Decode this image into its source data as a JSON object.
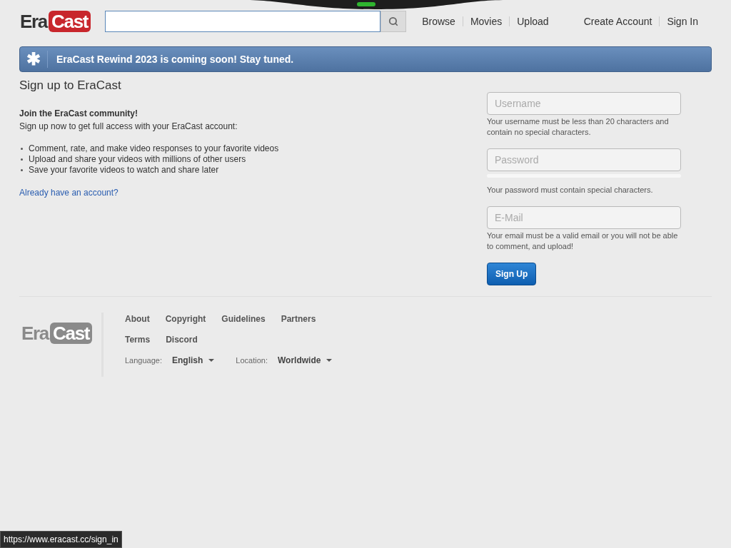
{
  "header": {
    "logo": {
      "part_1": "Era",
      "part_2": "Cast"
    },
    "nav": [
      "Browse",
      "Movies",
      "Upload"
    ],
    "account_links": [
      "Create Account",
      "Sign In"
    ]
  },
  "banner": {
    "icon": "✱",
    "text": "EraCast Rewind 2023 is coming soon! Stay tuned."
  },
  "signup": {
    "title": "Sign up to EraCast",
    "intro_heading": "Join the EraCast community!",
    "intro_text": "Sign up now to get full access with your EraCast account:",
    "benefits": [
      "Comment, rate, and make video responses to your favorite videos",
      "Upload and share your videos with millions of other users",
      "Save your favorite videos to watch and share later"
    ],
    "login_link": "Already have an account?"
  },
  "form": {
    "fields": [
      {
        "placeholder": "Username",
        "hint": "Your username must be less than 20 characters and contain no special characters."
      },
      {
        "placeholder": "Password",
        "hint": "Your password must contain special characters.",
        "strength_meter": true
      },
      {
        "placeholder": "E-Mail",
        "hint": "Your email must be a valid email or you will not be able to comment, and upload!"
      }
    ],
    "submit": "Sign Up"
  },
  "footer": {
    "logo": {
      "part_1": "Era",
      "part_2": "Cast"
    },
    "links": [
      [
        "About",
        "Copyright",
        "Guidelines",
        "Partners"
      ],
      [
        "Terms",
        "Discord"
      ]
    ],
    "selectors": [
      {
        "label": "Language:",
        "value": "English"
      },
      {
        "label": "Location:",
        "value": "Worldwide"
      }
    ]
  },
  "status_bar": {
    "url": "https://www.eracast.cc/sign_in"
  }
}
